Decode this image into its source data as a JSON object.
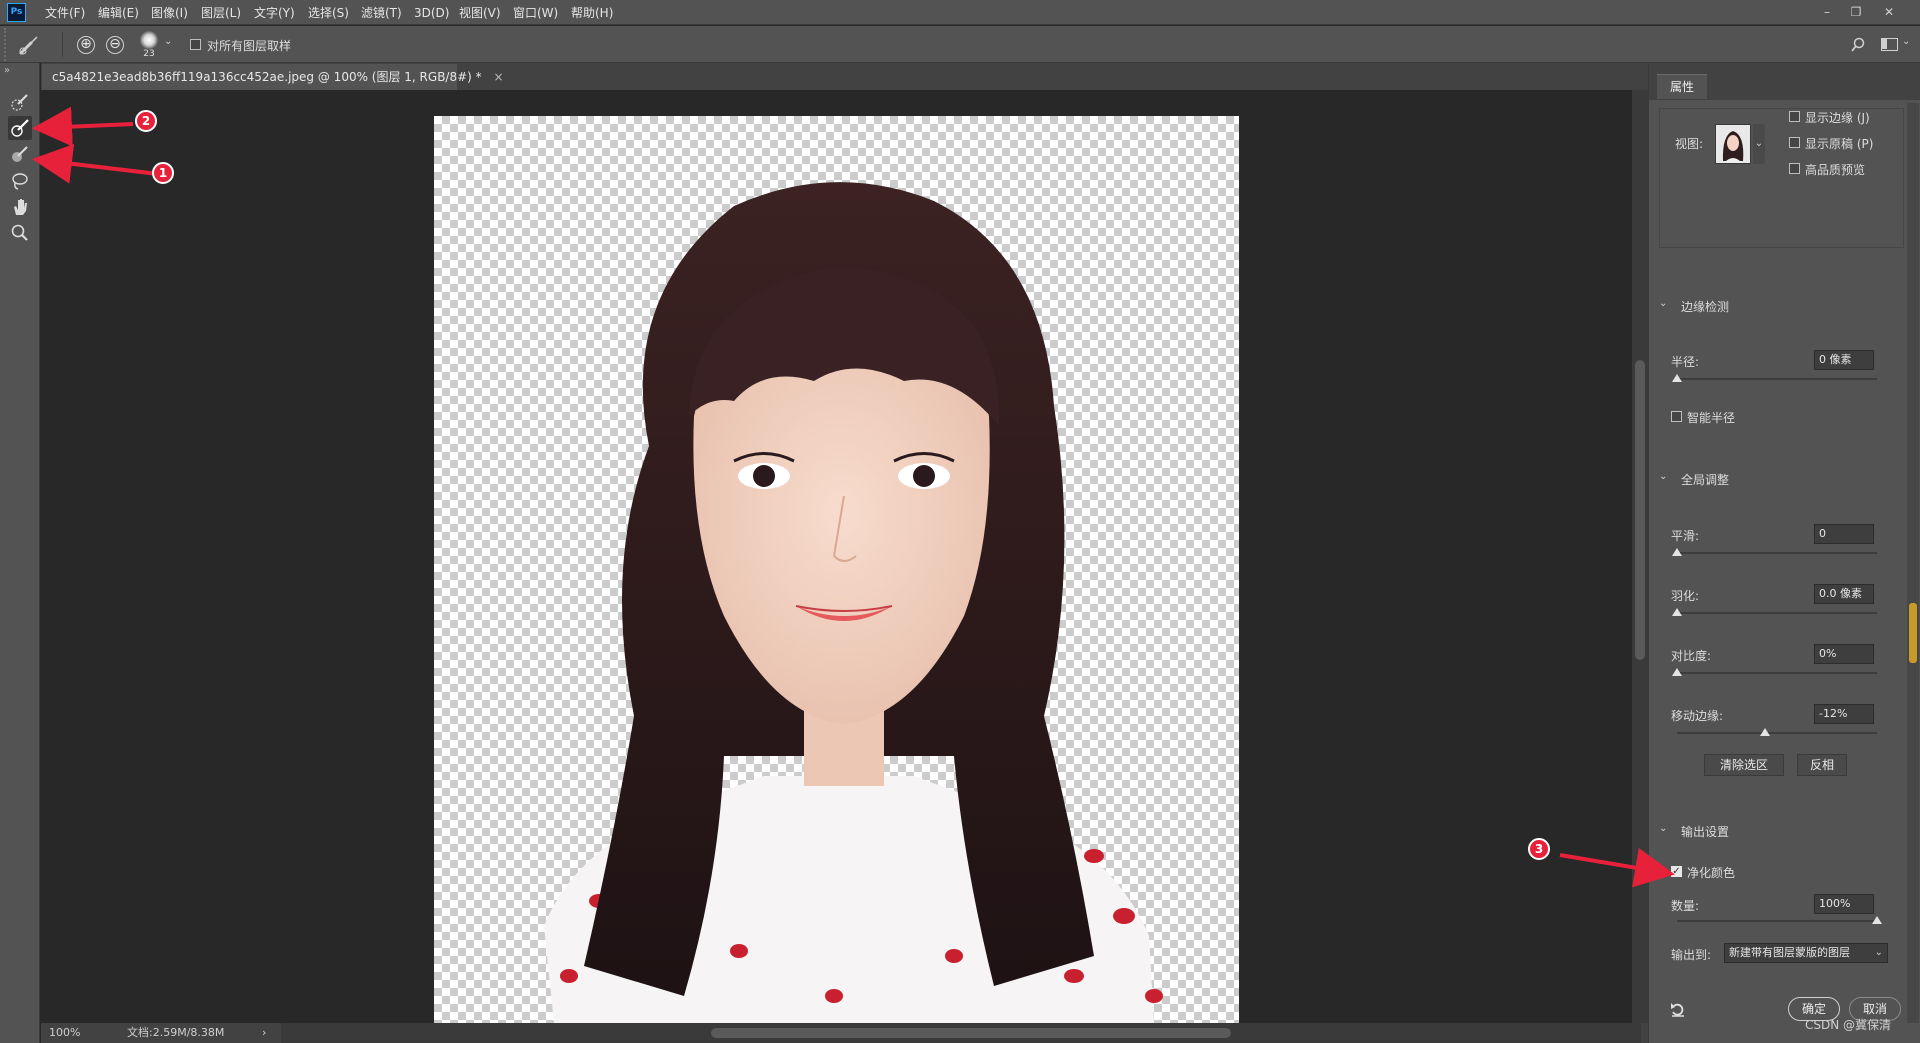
{
  "app": {
    "logo": "Ps"
  },
  "menu": [
    "文件(F)",
    "编辑(E)",
    "图像(I)",
    "图层(L)",
    "文字(Y)",
    "选择(S)",
    "滤镜(T)",
    "3D(D)",
    "视图(V)",
    "窗口(W)",
    "帮助(H)"
  ],
  "window_controls": {
    "minimize": "–",
    "restore": "❐",
    "close": "✕"
  },
  "options": {
    "tool_icon": "refine-edge-brush-icon",
    "add_icon": "⊕",
    "subtract_icon": "⊖",
    "brush_size": "23",
    "sample_all_label": "对所有图层取样",
    "sample_all_checked": false
  },
  "tools": [
    "quick-selection-icon",
    "refine-edge-brush-icon",
    "brush-icon",
    "lasso-icon",
    "hand-icon",
    "zoom-icon"
  ],
  "document": {
    "tab_title": "c5a4821e3ead8b36ff119a136cc452ae.jpeg @ 100% (图层 1, RGB/8#) *",
    "close_glyph": "×"
  },
  "status": {
    "zoom": "100%",
    "doc_size": "文档:2.59M/8.38M",
    "arrow": "›"
  },
  "panel": {
    "tab": "属性",
    "view_label": "视图:",
    "show_edge": "显示边缘 (J)",
    "show_original": "显示原稿 (P)",
    "hq_preview": "高品质预览",
    "edge_detection": {
      "title": "边缘检测",
      "radius_label": "半径:",
      "radius_value": "0 像素",
      "radius_level": 0,
      "smart_radius": "智能半径"
    },
    "global": {
      "title": "全局调整",
      "smooth_label": "平滑:",
      "smooth_value": "0",
      "smooth_level": 0,
      "feather_label": "羽化:",
      "feather_value": "0.0 像素",
      "feather_level": 0,
      "contrast_label": "对比度:",
      "contrast_value": "0%",
      "contrast_level": 0,
      "shift_label": "移动边缘:",
      "shift_value": "-12%",
      "shift_level": 0.44,
      "clear_btn": "清除选区",
      "invert_btn": "反相"
    },
    "output": {
      "title": "输出设置",
      "decontaminate": "净化颜色",
      "decontaminate_checked": true,
      "amount_label": "数量:",
      "amount_value": "100%",
      "amount_level": 1,
      "output_to_label": "输出到:",
      "output_to_value": "新建带有图层蒙版的图层"
    },
    "ok": "确定",
    "cancel": "取消"
  },
  "annotations": {
    "one": "1",
    "two": "2",
    "three": "3",
    "arrow_color": "#e8213a"
  },
  "watermark": "CSDN @冀保清"
}
